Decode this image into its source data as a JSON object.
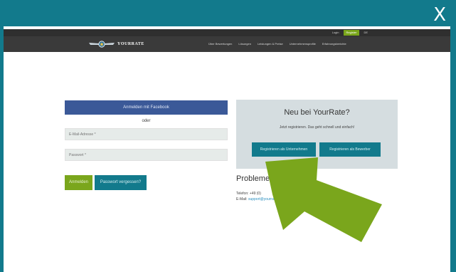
{
  "window": {
    "close_label": "X"
  },
  "topbar": {
    "login": "Login",
    "register": "Register",
    "lang": "DE"
  },
  "navbar": {
    "brand": "YOURRATE",
    "menu": [
      "Über Bewertungen",
      "Lösungen",
      "Leistungen & Preise",
      "Unternehmensprofile",
      "Erfahrungsberichte"
    ]
  },
  "login_form": {
    "facebook": "Anmelden mit Facebook",
    "or": "oder",
    "email_placeholder": "E-Mail-Adresse *",
    "password_placeholder": "Passwort *",
    "login": "Anmelden",
    "forgot": "Passwort vergessen?"
  },
  "signup": {
    "title": "Neu bei YourRate?",
    "subtitle": "Jetzt registrieren. Das geht schnell und einfach!",
    "company_button": "Registrieren als Unternehmen",
    "applicant_button": "Registrieren als Bewerber"
  },
  "help": {
    "title": "Probleme?",
    "phone_label": "Telefon: +49 (0)",
    "email_label": "E-Mail: ",
    "email_value": "support@yourrate.de"
  },
  "colors": {
    "teal": "#127a8c",
    "green": "#7aa61c",
    "facebook": "#3b5998",
    "arrow": "#7aa61c"
  },
  "overlay": {
    "icon": "arrow-up-left-icon"
  }
}
